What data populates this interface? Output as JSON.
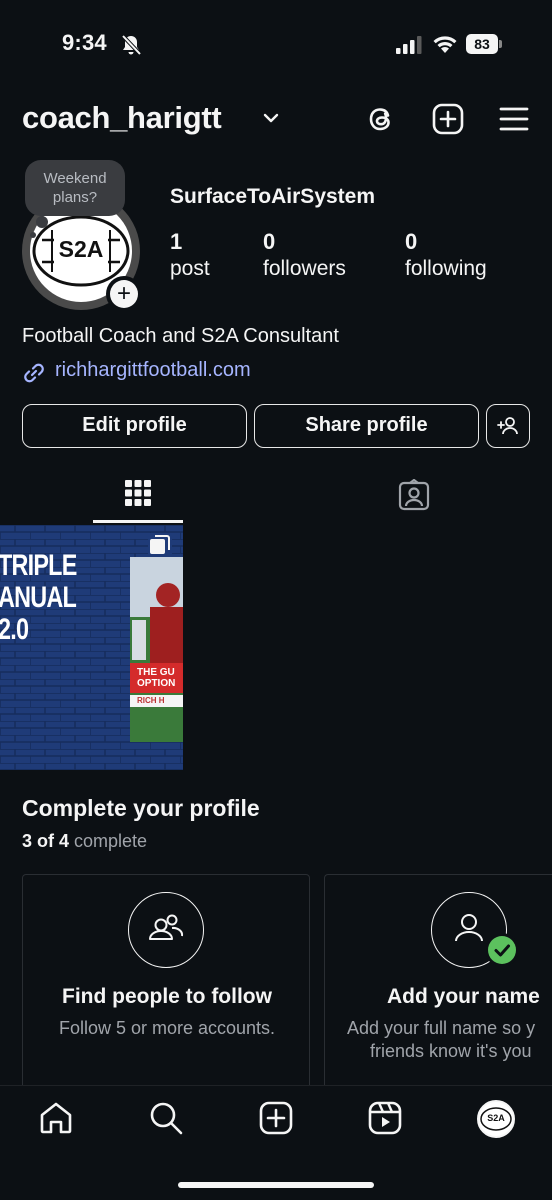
{
  "status": {
    "time": "9:34",
    "battery": "83"
  },
  "header": {
    "username": "coach_harigtt"
  },
  "profile": {
    "note": "Weekend plans?",
    "avatar_text": "S2A",
    "display_name": "SurfaceToAirSystem",
    "stats": [
      {
        "value": "1",
        "label": "post"
      },
      {
        "value": "0",
        "label": "followers"
      },
      {
        "value": "0",
        "label": "following"
      }
    ],
    "bio": "Football Coach and S2A Consultant",
    "link": "richhargittfootball.com"
  },
  "actions": {
    "edit": "Edit profile",
    "share": "Share profile"
  },
  "post": {
    "title_lines": [
      "TRIPLE",
      "ANUAL",
      "2.0"
    ],
    "book_lines": [
      "THE GU",
      "OPTION",
      "RICH H"
    ]
  },
  "complete_profile": {
    "title": "Complete your profile",
    "progress_bold": "3 of 4",
    "progress_rest": "complete",
    "cards": [
      {
        "title": "Find people to follow",
        "desc_lines": [
          "Follow 5 or more accounts."
        ]
      },
      {
        "title": "Add your name",
        "desc_lines": [
          "Add your full name so y",
          "friends know it's you"
        ]
      }
    ]
  },
  "nav": {
    "profile_avatar_text": "S2A"
  },
  "colors": {
    "background": "#0c1014",
    "link": "#a6b5ff",
    "check": "#5cc15e"
  }
}
